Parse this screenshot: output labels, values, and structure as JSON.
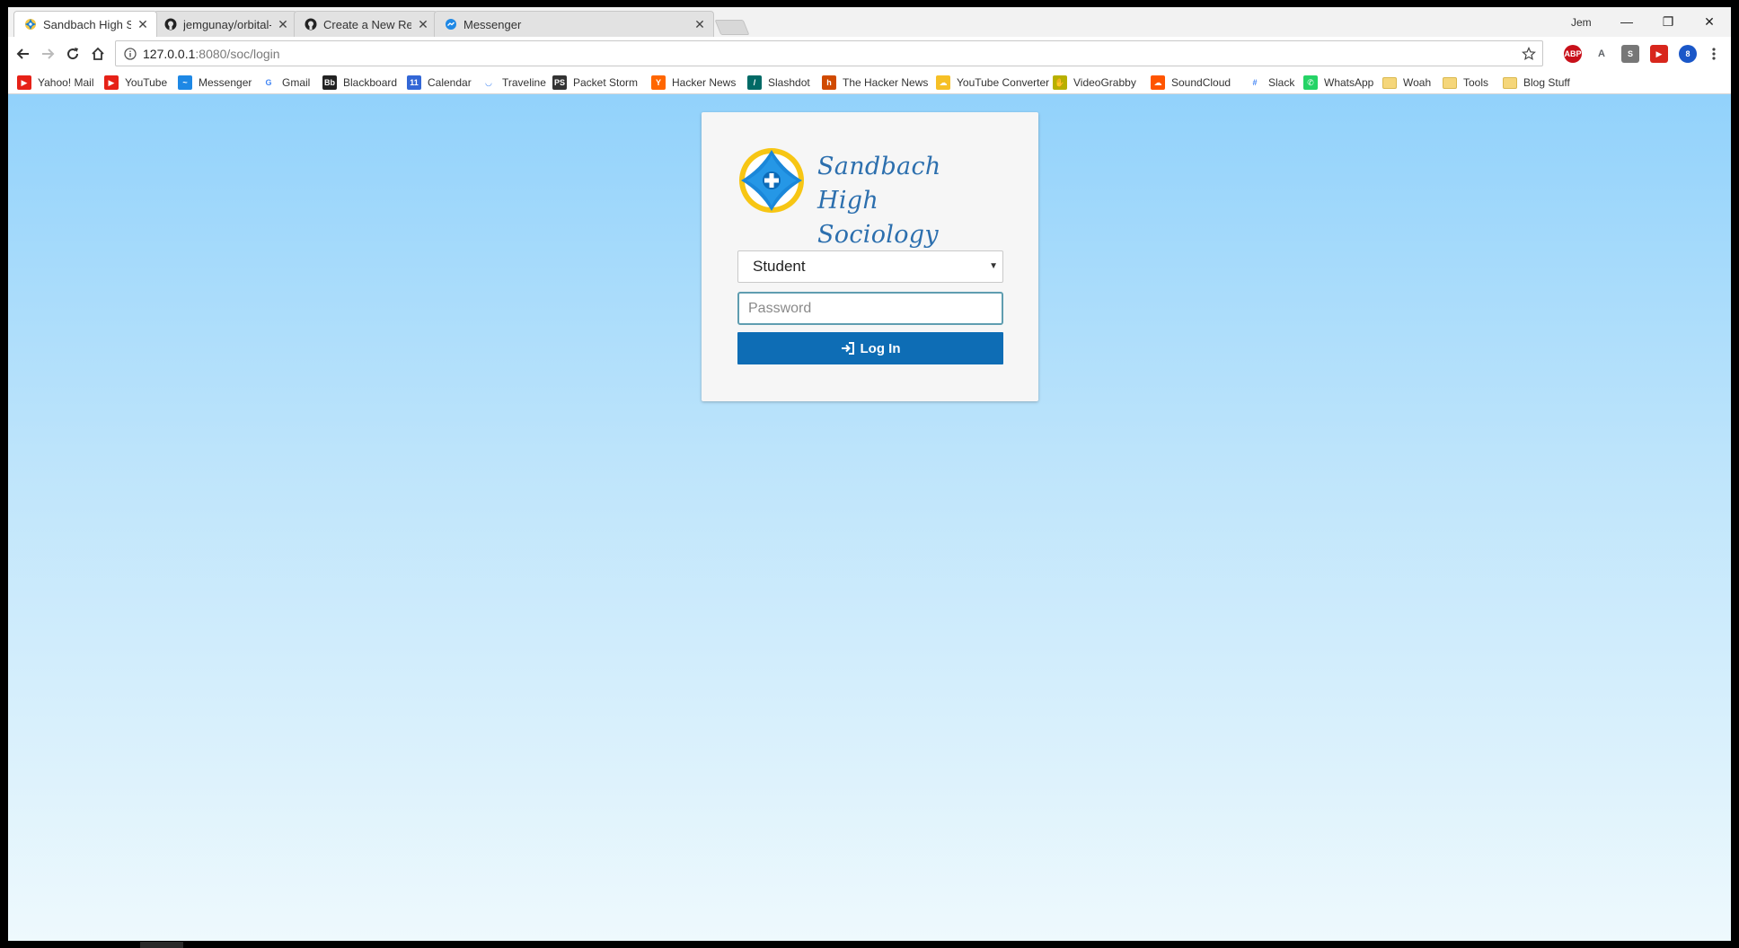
{
  "tabs": [
    {
      "title": "Sandbach High Sociolog",
      "favicon": "school-logo-icon",
      "active": true
    },
    {
      "title": "jemgunay/orbital-sim: D",
      "favicon": "github-icon",
      "active": false
    },
    {
      "title": "Create a New Repository",
      "favicon": "github-icon",
      "active": false
    },
    {
      "title": "Messenger",
      "favicon": "messenger-icon",
      "active": false
    }
  ],
  "window": {
    "profile_name": "Jem",
    "minimize_glyph": "—",
    "restore_glyph": "❐",
    "close_glyph": "✕"
  },
  "toolbar": {
    "url_host": "127.0.0.1",
    "url_path": ":8080/soc/login",
    "extensions": [
      {
        "name": "adblock-plus-icon",
        "label": "ABP",
        "color": "#c8101a"
      },
      {
        "name": "translate-icon",
        "label": "A",
        "color": "#5f6368"
      },
      {
        "name": "s-extension-icon",
        "label": "S",
        "color": "#777777"
      },
      {
        "name": "red-extension-icon",
        "label": "▶",
        "color": "#d8261c"
      },
      {
        "name": "blue-extension-icon",
        "label": "8",
        "color": "#1a57c8"
      }
    ]
  },
  "bookmarks": [
    {
      "label": "Yahoo! Mail",
      "icon": "youtube-icon",
      "color": "#e62117",
      "glyph": "▶"
    },
    {
      "label": "YouTube",
      "icon": "youtube-icon",
      "color": "#e62117",
      "glyph": "▶"
    },
    {
      "label": "Messenger",
      "icon": "messenger-icon",
      "color": "#1e88e5",
      "glyph": "~"
    },
    {
      "label": "Gmail",
      "icon": "google-icon",
      "color": "#ffffff",
      "glyph": "G"
    },
    {
      "label": "Blackboard",
      "icon": "blackboard-icon",
      "color": "#222222",
      "glyph": "Bb"
    },
    {
      "label": "Calendar",
      "icon": "calendar-icon",
      "color": "#3367d6",
      "glyph": "11"
    },
    {
      "label": "Traveline",
      "icon": "traveline-icon",
      "color": "#ffffff",
      "glyph": "◡"
    },
    {
      "label": "Packet Storm",
      "icon": "packetstorm-icon",
      "color": "#333333",
      "glyph": "PS"
    },
    {
      "label": "Hacker News",
      "icon": "hackernews-icon",
      "color": "#ff6600",
      "glyph": "Y"
    },
    {
      "label": "Slashdot",
      "icon": "slashdot-icon",
      "color": "#016a66",
      "glyph": "/"
    },
    {
      "label": "The Hacker News",
      "icon": "thehackernews-icon",
      "color": "#d04a00",
      "glyph": "h"
    },
    {
      "label": "YouTube Converter",
      "icon": "converter-icon",
      "color": "#f6c026",
      "glyph": "☁"
    },
    {
      "label": "VideoGrabby",
      "icon": "videograbby-icon",
      "color": "#b8b000",
      "glyph": "✋"
    },
    {
      "label": "SoundCloud",
      "icon": "soundcloud-icon",
      "color": "#ff5500",
      "glyph": "☁"
    },
    {
      "label": "Slack",
      "icon": "slack-icon",
      "color": "#ffffff",
      "glyph": "#"
    },
    {
      "label": "WhatsApp",
      "icon": "whatsapp-icon",
      "color": "#25d366",
      "glyph": "✆"
    },
    {
      "label": "Woah",
      "icon": "folder-icon",
      "color": "#f5d67a",
      "glyph": ""
    },
    {
      "label": "Tools",
      "icon": "folder-icon",
      "color": "#f5d67a",
      "glyph": ""
    },
    {
      "label": "Blog Stuff",
      "icon": "folder-icon",
      "color": "#f5d67a",
      "glyph": ""
    }
  ],
  "login": {
    "brand_line1": "Sandbach High",
    "brand_line2": "Sociology",
    "role_selected": "Student",
    "password_placeholder": "Password",
    "login_label": "Log In"
  },
  "colors": {
    "accent": "#0e6db5",
    "brand_text": "#2c6fae",
    "background_top": "#92d2fb",
    "background_bottom": "#eef9fd"
  }
}
